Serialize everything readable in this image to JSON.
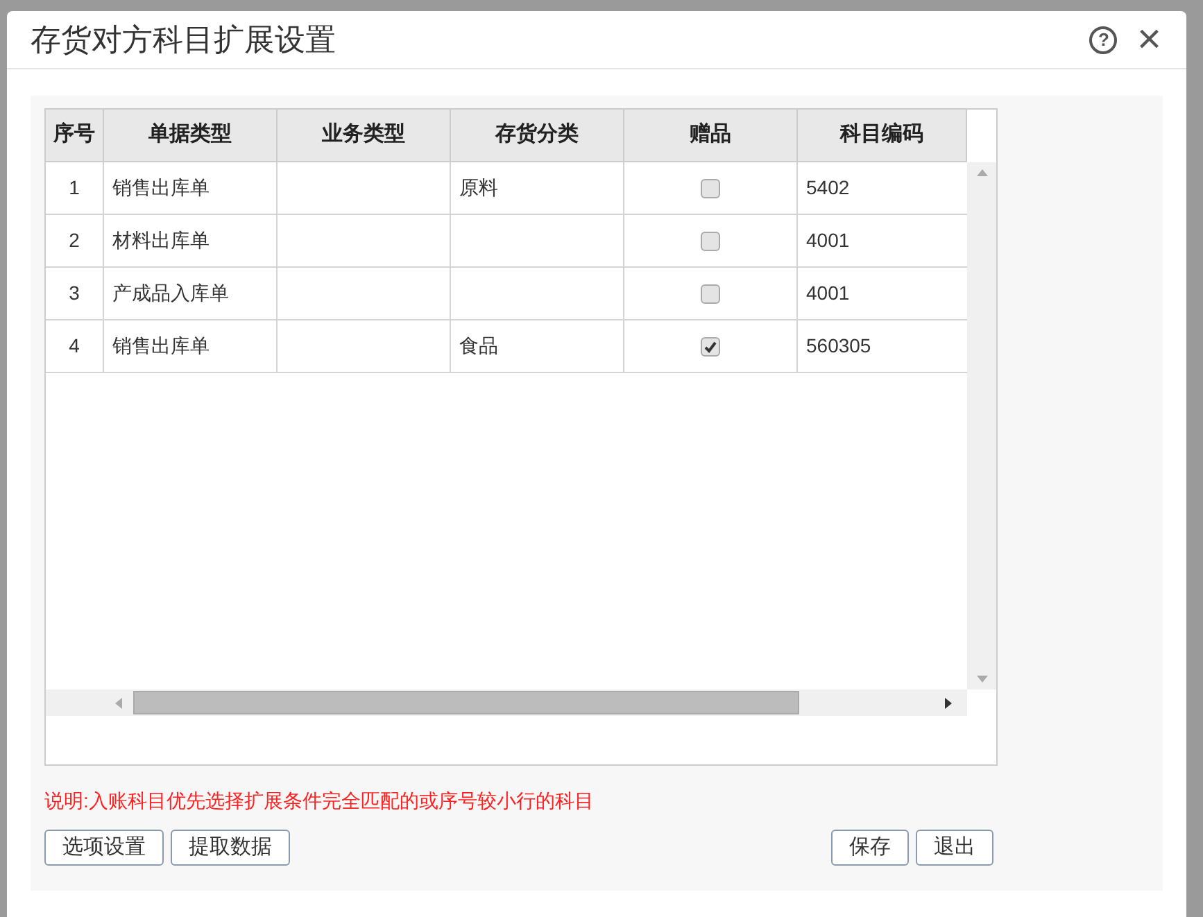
{
  "dialog": {
    "title": "存货对方科目扩展设置",
    "help": "?",
    "close": "×"
  },
  "table": {
    "columns": [
      "序号",
      "单据类型",
      "业务类型",
      "存货分类",
      "赠品",
      "科目编码"
    ],
    "rows": [
      {
        "index": "1",
        "bill_type": "销售出库单",
        "category": "原料",
        "gift": false,
        "account": "5402"
      },
      {
        "index": "2",
        "bill_type": "材料出库单",
        "gift": false,
        "account": "4001"
      },
      {
        "index": "3",
        "bill_type": "产成品入库单",
        "gift": false,
        "account": "4001"
      },
      {
        "index": "4",
        "bill_type": "销售出库单",
        "category": "食品",
        "gift": true,
        "account": "560305"
      }
    ]
  },
  "note": "说明:入账科目优先选择扩展条件完全匹配的或序号较小行的科目",
  "left_buttons": [
    "选项设置",
    "提取数据"
  ],
  "right_buttons": [
    "保存",
    "退出"
  ]
}
